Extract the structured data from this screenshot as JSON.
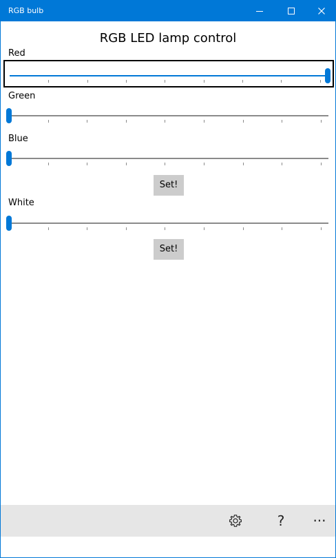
{
  "window": {
    "title": "RGB bulb",
    "accent_color": "#0078d7",
    "controls": [
      "minimize-icon",
      "maximize-icon",
      "close-icon"
    ]
  },
  "main": {
    "title": "RGB LED lamp control"
  },
  "sliders": {
    "red": {
      "label": "Red",
      "level_fraction": 1.0,
      "focused": true
    },
    "green": {
      "label": "Green",
      "level_fraction": 0.0
    },
    "blue": {
      "label": "Blue",
      "level_fraction": 0.0
    },
    "white": {
      "label": "White",
      "level_fraction": 0.0
    }
  },
  "buttons": {
    "set_rgb": "Set!",
    "set_white": "Set!"
  },
  "appbar": {
    "icons": [
      "gear-icon",
      "help-icon",
      "more-icon"
    ],
    "help_glyph": "?",
    "more_glyph": "···"
  }
}
